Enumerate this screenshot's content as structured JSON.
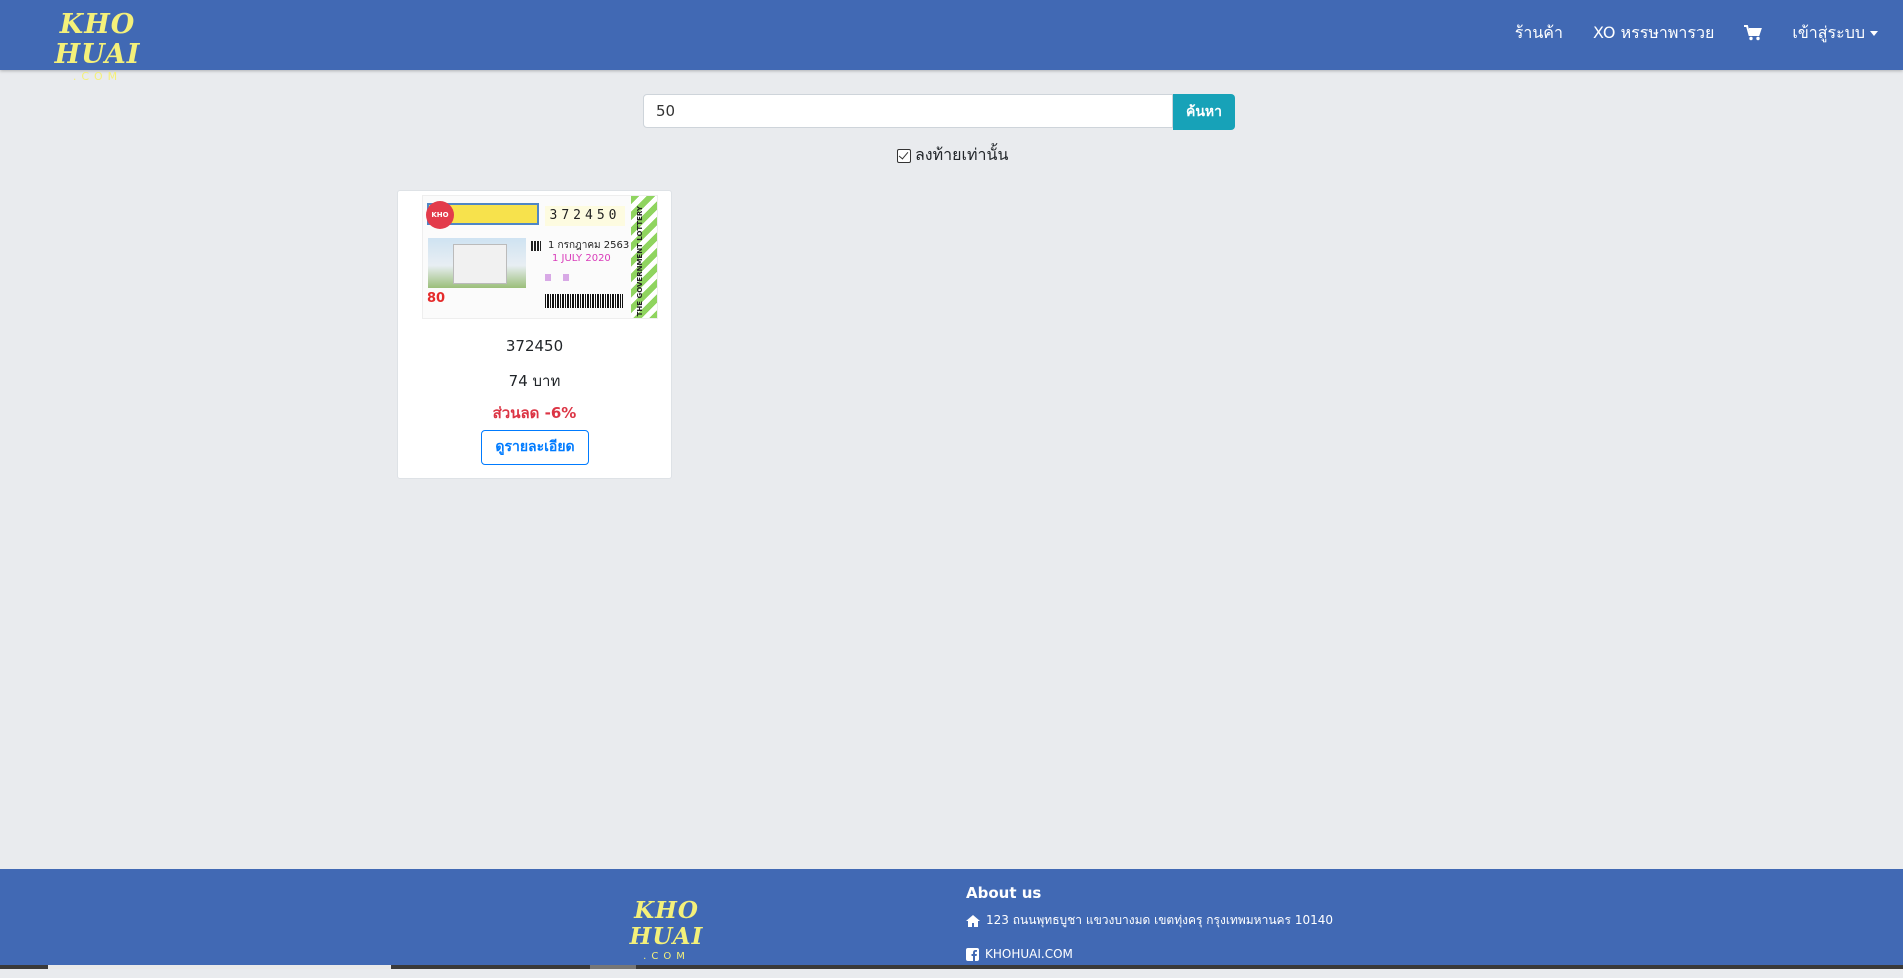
{
  "brand": {
    "name": "KHO HUAI",
    "sub": ".COM"
  },
  "nav": {
    "shop": "ร้านค้า",
    "xo": "XO หรรษาพารวย",
    "cart_icon": "shopping-cart-icon",
    "login": "เข้าสู่ระบบ"
  },
  "search": {
    "value": "50",
    "button": "ค้นหา",
    "checkbox_label": "ลงท้ายเท่านั้น",
    "checkbox_checked": true
  },
  "results": [
    {
      "number": "372450",
      "price": "74 บาท",
      "discount": "ส่วนลด -6%",
      "button": "ดูรายละเอียด",
      "ticket": {
        "digits": "372450",
        "date_th": "1 กรกฎาคม 2563",
        "date_en": "1 JULY 2020",
        "price": "80",
        "side_text": "THE GOVERNMENT LOTTERY"
      }
    }
  ],
  "footer": {
    "about_title": "About us",
    "address": "123 ถนนพุทธบูชา แขวงบางมด เขตทุ่งครุ กรุงเทพมหานคร 10140",
    "facebook": "KHOHUAI.COM"
  },
  "colors": {
    "primary": "#4169b4",
    "accent": "#17a2b8",
    "logo": "#f4f07a",
    "danger": "#dc3545"
  }
}
